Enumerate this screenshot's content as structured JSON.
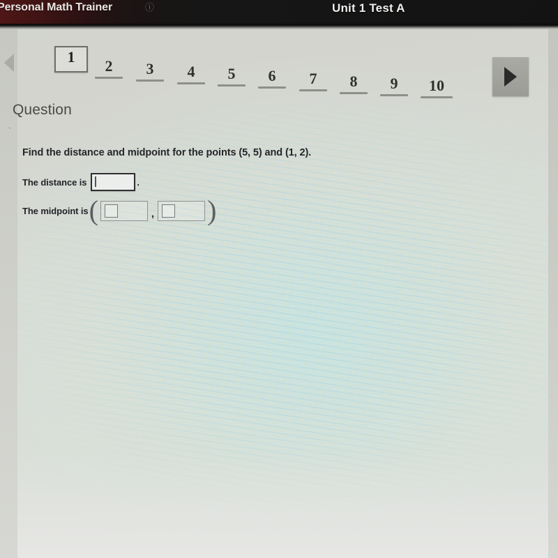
{
  "header": {
    "app_title": "Personal Math Trainer",
    "app_title_icon": "info-circle-icon",
    "unit_title": "Unit 1 Test A"
  },
  "pager": {
    "prev_icon": "triangle-left-icon",
    "next_icon": "triangle-right-icon",
    "current": "1",
    "items": [
      {
        "label": "1",
        "current": true
      },
      {
        "label": "2",
        "current": false
      },
      {
        "label": "3",
        "current": false
      },
      {
        "label": "4",
        "current": false
      },
      {
        "label": "5",
        "current": false
      },
      {
        "label": "6",
        "current": false
      },
      {
        "label": "7",
        "current": false
      },
      {
        "label": "8",
        "current": false
      },
      {
        "label": "9",
        "current": false
      },
      {
        "label": "10",
        "current": false
      }
    ]
  },
  "content": {
    "heading": "Question",
    "question_text": "Find the distance and midpoint for the points (5, 5) and (1, 2).",
    "distance": {
      "label": "The distance is",
      "value": "",
      "trailing": "."
    },
    "midpoint": {
      "label": "The midpoint is",
      "open_paren": "(",
      "close_paren": ")",
      "separator": ",",
      "x_value": "",
      "y_value": ""
    }
  },
  "colors": {
    "appbar_bg": "#161616",
    "appbar_accent": "#3a1414",
    "page_bg": "#d6d8d2",
    "text_primary": "#26262a",
    "heading": "#4a4a48",
    "rule": "#8e8f89",
    "next_button": "#a9aaa4"
  }
}
